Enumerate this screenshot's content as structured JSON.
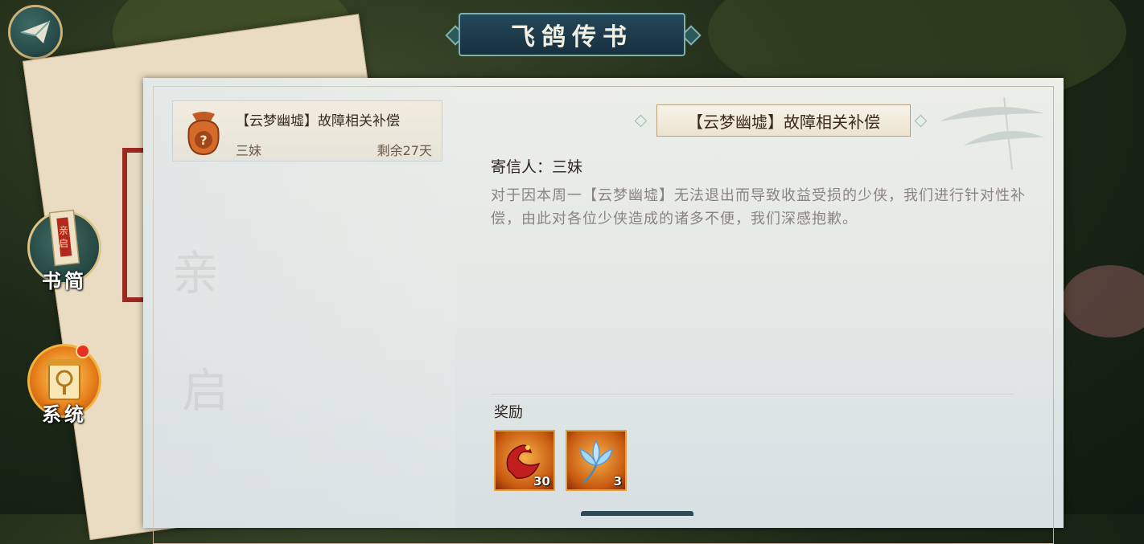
{
  "header": {
    "title": "飞鸽传书"
  },
  "side_tabs": [
    {
      "label": "书简",
      "badge": "亲启"
    },
    {
      "label": "系统"
    }
  ],
  "watermark": {
    "line1": "亲",
    "line2": "启"
  },
  "mail_list": [
    {
      "subject": "【云梦幽墟】故障相关补偿",
      "sender": "三妹",
      "remaining": "剩余27天",
      "icon": "mystery-bag-icon"
    }
  ],
  "detail": {
    "subject": "【云梦幽墟】故障相关补偿",
    "sender_line": "寄信人：三妹",
    "body": "对于因本周一【云梦幽墟】无法退出而导致收益受损的少侠，我们进行针对性补偿，由此对各位少侠造成的诸多不便，我们深感抱歉。",
    "rewards_label": "奖励",
    "rewards": [
      {
        "icon": "red-dragon-icon",
        "count": "30"
      },
      {
        "icon": "blue-lotus-icon",
        "count": "3"
      }
    ]
  },
  "colors": {
    "accent": "#e2a13c",
    "banner": "#24485a",
    "seal": "#9c2a22",
    "notify_dot": "#e8321f"
  }
}
